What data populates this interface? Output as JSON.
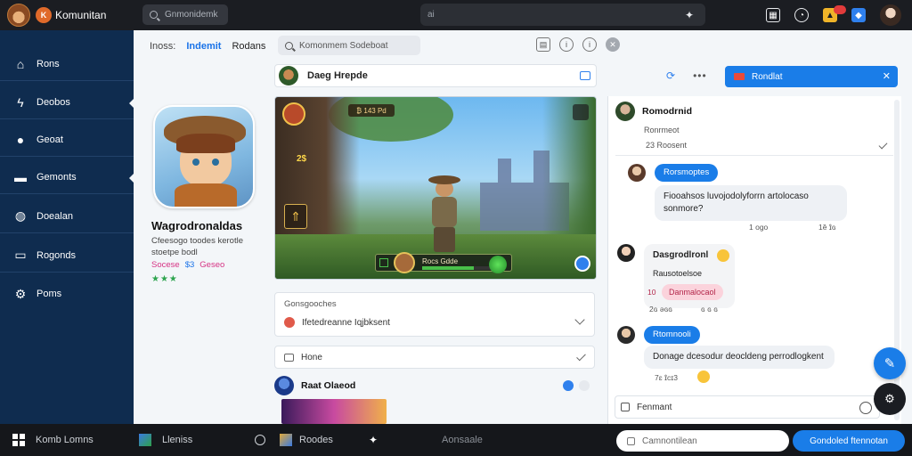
{
  "app": {
    "name": "Komunitan"
  },
  "topbar": {
    "search_placeholder": "Gnmonidemk",
    "center_placeholder": "ai",
    "icons": [
      "pin-icon",
      "grid-icon",
      "chat-icon",
      "gold-badge-icon",
      "blue-app-icon",
      "user-avatar"
    ]
  },
  "sidebar": {
    "items": [
      {
        "label": "Rons",
        "icon": "home-icon"
      },
      {
        "label": "Deobos",
        "icon": "bolt-icon"
      },
      {
        "label": "Geoat",
        "icon": "user-icon"
      },
      {
        "label": "Gemonts",
        "icon": "folder-icon"
      },
      {
        "label": "Doealan",
        "icon": "globe-icon"
      },
      {
        "label": "Rogonds",
        "icon": "screen-icon"
      },
      {
        "label": "Poms",
        "icon": "gear-icon"
      }
    ]
  },
  "breadcrumb": {
    "c1": "Inoss:",
    "c2": "Indemit",
    "c3": "Rodans"
  },
  "main_search": {
    "placeholder": "Komonmem Sodeboat"
  },
  "profile": {
    "name": "Wagrodronaldas",
    "description": "Cfeesogo toodes kerotle stoetpe bodl",
    "stat1": "Socese",
    "stat2": "$3",
    "stat3": "Geseo",
    "stars": "★★★"
  },
  "game_card": {
    "title": "Daeg Hrepde",
    "hud_chip": "₿ 143 Pd",
    "hud_num": "2$",
    "hud_sq_glyph": "⇑",
    "bar_label": "Rocs Gdde",
    "bar_fill": 0.72
  },
  "quest_card": {
    "label": "Gonsgooches",
    "item": "Ifetedreanne Iqjbksent"
  },
  "hide_card": {
    "label": "Hone"
  },
  "feed": {
    "name": "Raat Olaeod"
  },
  "chat": {
    "header_button": "Rondlat",
    "header_button_x": "✕",
    "thread": {
      "name": "Romodrnid",
      "meta1": "Ronrmeot",
      "meta2": "23 Roosent"
    },
    "messages": [
      {
        "pill": "Rorsmoptes",
        "text": "Fiooahsos luvojodolyforrn artolocaso sonmore?",
        "time": "1 ogo",
        "time2": "1ȅ ɪ̂ɢ"
      },
      {
        "title": "Dasgrodlronl",
        "sub": "Rausotoelsoe",
        "tag_num": "10",
        "tag": "Danmalocaol",
        "time": "2ɢ ǝɢɢ",
        "time2": "ɢ ɢ ɢ"
      },
      {
        "pill": "Rtomnooli",
        "text": "Donage dcesodur deocldeng perrodlogkent",
        "time": "7ɛ ɪ̂cɪ3"
      }
    ],
    "composer_placeholder": "Fenmant"
  },
  "taskbar": {
    "items": [
      "Komb Lomns",
      "Lleniss",
      "Roodes",
      "Aonsaale"
    ],
    "compose_placeholder": "Camnontilean",
    "action_button": "Gondoled ftennotan"
  },
  "colors": {
    "sidebar": "#0f2c4f",
    "accent": "#1a7de8",
    "topbar": "#1b1d22"
  }
}
